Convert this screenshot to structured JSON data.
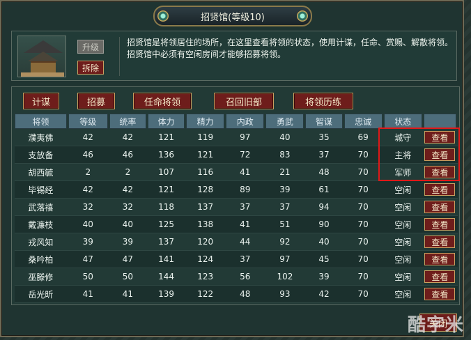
{
  "window": {
    "title": "招贤馆(等级10)"
  },
  "building": {
    "upgrade_label": "升级",
    "demolish_label": "拆除",
    "description": "招贤馆是将领居住的场所，在这里查看将领的状态，使用计谋，任命、赏赐、解散将领。招贤馆中必须有空闲房间才能够招募将领。"
  },
  "toolbar": [
    {
      "label": "计谋"
    },
    {
      "label": "招募"
    },
    {
      "label": "任命将领"
    },
    {
      "label": "召回旧部"
    },
    {
      "label": "将领历练"
    }
  ],
  "table": {
    "columns": [
      "将领",
      "等级",
      "统率",
      "体力",
      "精力",
      "内政",
      "勇武",
      "智谋",
      "忠诚",
      "状态",
      ""
    ],
    "view_label": "查看",
    "rows": [
      {
        "name": "濮夷佛",
        "level": "42",
        "command": "42",
        "stamina": "121",
        "energy": "119",
        "politics": "97",
        "valor": "40",
        "wisdom": "35",
        "loyalty": "69",
        "status": "城守"
      },
      {
        "name": "支放备",
        "level": "46",
        "command": "46",
        "stamina": "136",
        "energy": "121",
        "politics": "72",
        "valor": "83",
        "wisdom": "37",
        "loyalty": "70",
        "status": "主将"
      },
      {
        "name": "胡西毓",
        "level": "2",
        "command": "2",
        "stamina": "107",
        "energy": "116",
        "politics": "41",
        "valor": "21",
        "wisdom": "48",
        "loyalty": "70",
        "status": "军师"
      },
      {
        "name": "毕锡经",
        "level": "42",
        "command": "42",
        "stamina": "121",
        "energy": "128",
        "politics": "89",
        "valor": "39",
        "wisdom": "61",
        "loyalty": "70",
        "status": "空闲"
      },
      {
        "name": "武落禧",
        "level": "32",
        "command": "32",
        "stamina": "118",
        "energy": "137",
        "politics": "37",
        "valor": "37",
        "wisdom": "94",
        "loyalty": "70",
        "status": "空闲"
      },
      {
        "name": "戴濂枝",
        "level": "40",
        "command": "40",
        "stamina": "125",
        "energy": "138",
        "politics": "41",
        "valor": "51",
        "wisdom": "90",
        "loyalty": "70",
        "status": "空闲"
      },
      {
        "name": "戎风知",
        "level": "39",
        "command": "39",
        "stamina": "137",
        "energy": "120",
        "politics": "44",
        "valor": "92",
        "wisdom": "40",
        "loyalty": "70",
        "status": "空闲"
      },
      {
        "name": "桑吟柏",
        "level": "47",
        "command": "47",
        "stamina": "141",
        "energy": "124",
        "politics": "37",
        "valor": "97",
        "wisdom": "45",
        "loyalty": "70",
        "status": "空闲"
      },
      {
        "name": "巫滕修",
        "level": "50",
        "command": "50",
        "stamina": "144",
        "energy": "123",
        "politics": "56",
        "valor": "102",
        "wisdom": "39",
        "loyalty": "70",
        "status": "空闲"
      },
      {
        "name": "岳光昕",
        "level": "41",
        "command": "41",
        "stamina": "139",
        "energy": "122",
        "politics": "48",
        "valor": "93",
        "wisdom": "42",
        "loyalty": "70",
        "status": "空闲"
      }
    ]
  },
  "footer": {
    "close_label": "关闭"
  },
  "watermark": {
    "text": "酷字米"
  },
  "colors": {
    "button_red": "#6e1d1b",
    "header_blue": "#4d6d7b",
    "highlight": "#e01818"
  }
}
